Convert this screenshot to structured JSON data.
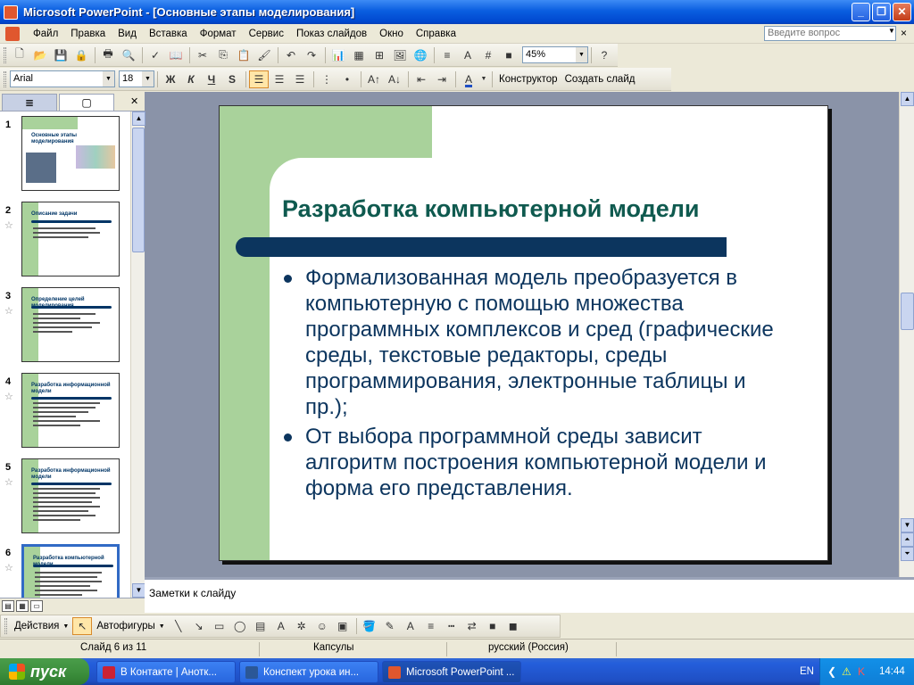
{
  "window": {
    "title": "Microsoft PowerPoint - [Основные этапы моделирования]",
    "minimize": "_",
    "restore": "❐",
    "close": "✕"
  },
  "menu": {
    "items": [
      "Файл",
      "Правка",
      "Вид",
      "Вставка",
      "Формат",
      "Сервис",
      "Показ слайдов",
      "Окно",
      "Справка"
    ],
    "help_placeholder": "Введите вопрос",
    "doc_close": "×"
  },
  "toolbar1": {
    "zoom": "45%"
  },
  "toolbar2": {
    "font": "Arial",
    "size": "18",
    "bold": "Ж",
    "italic": "К",
    "underline": "Ч",
    "shadow": "S",
    "designer": "Конструктор",
    "new_slide": "Создать слайд"
  },
  "thumbnails": [
    {
      "num": "1",
      "title": "Основные этапы моделирования"
    },
    {
      "num": "2",
      "title": "Описание задачи"
    },
    {
      "num": "3",
      "title": "Определение целей моделирования"
    },
    {
      "num": "4",
      "title": "Разработка информационной модели"
    },
    {
      "num": "5",
      "title": "Разработка информационной модели"
    },
    {
      "num": "6",
      "title": "Разработка компьютерной модели"
    }
  ],
  "slide": {
    "title": "Разработка компьютерной модели",
    "bullets": [
      "Формализованная модель преобразуется в компьютерную с помощью множества программных комплексов и сред (графические среды, текстовые редакторы, среды программирования, электронные таблицы и пр.);",
      "От выбора программной среды зависит алгоритм построения компьютерной модели и форма его представления."
    ]
  },
  "notes": {
    "placeholder": "Заметки к слайду"
  },
  "drawbar": {
    "actions": "Действия",
    "autoshapes": "Автофигуры"
  },
  "status": {
    "slide": "Слайд 6 из 11",
    "design": "Капсулы",
    "language": "русский (Россия)"
  },
  "taskbar": {
    "start": "пуск",
    "tasks": [
      "В Контакте | Анотк...",
      "Конспект урока  ин...",
      "Microsoft PowerPoint ..."
    ],
    "lang": "EN",
    "time": "14:44"
  }
}
